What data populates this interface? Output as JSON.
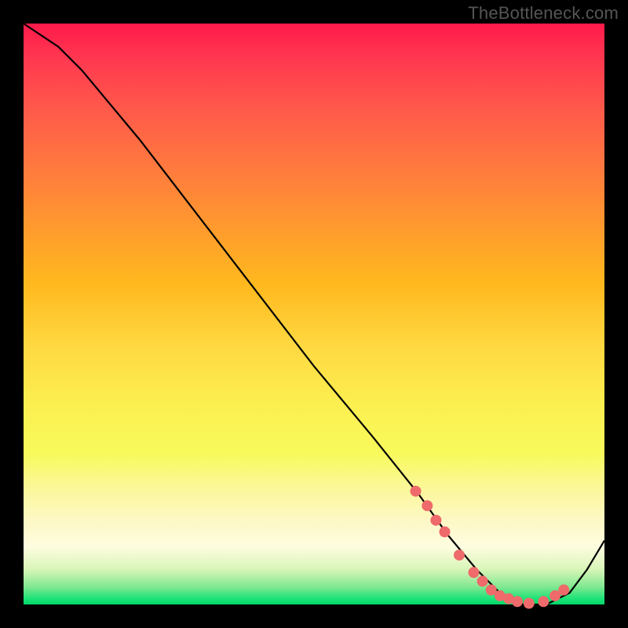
{
  "watermark": "TheBottleneck.com",
  "colors": {
    "background": "#000000",
    "curve": "#000000",
    "dots": "#ef6a6a",
    "gradient_top": "#ff1a4a",
    "gradient_mid": "#ffd740",
    "gradient_bottom": "#00d968"
  },
  "chart_data": {
    "type": "line",
    "title": "",
    "xlabel": "",
    "ylabel": "",
    "xlim": [
      0,
      100
    ],
    "ylim": [
      0,
      100
    ],
    "series": [
      {
        "name": "bottleneck-curve",
        "x": [
          0,
          6,
          10,
          20,
          30,
          40,
          50,
          60,
          68,
          73,
          78,
          82,
          86,
          90,
          94,
          97,
          100
        ],
        "y": [
          100,
          96,
          92,
          80,
          67,
          54,
          41,
          29,
          19,
          12,
          6,
          2,
          0,
          0,
          2,
          6,
          11
        ]
      }
    ],
    "markers": {
      "name": "highlight-dots",
      "x": [
        67.5,
        69.5,
        71.0,
        72.5,
        75.0,
        77.5,
        79.0,
        80.5,
        82.0,
        83.5,
        85.0,
        87.0,
        89.5,
        91.5,
        93.0
      ],
      "y": [
        19.5,
        17.0,
        14.5,
        12.5,
        8.5,
        5.5,
        4.0,
        2.5,
        1.5,
        1.0,
        0.5,
        0.2,
        0.5,
        1.5,
        2.5
      ]
    }
  }
}
